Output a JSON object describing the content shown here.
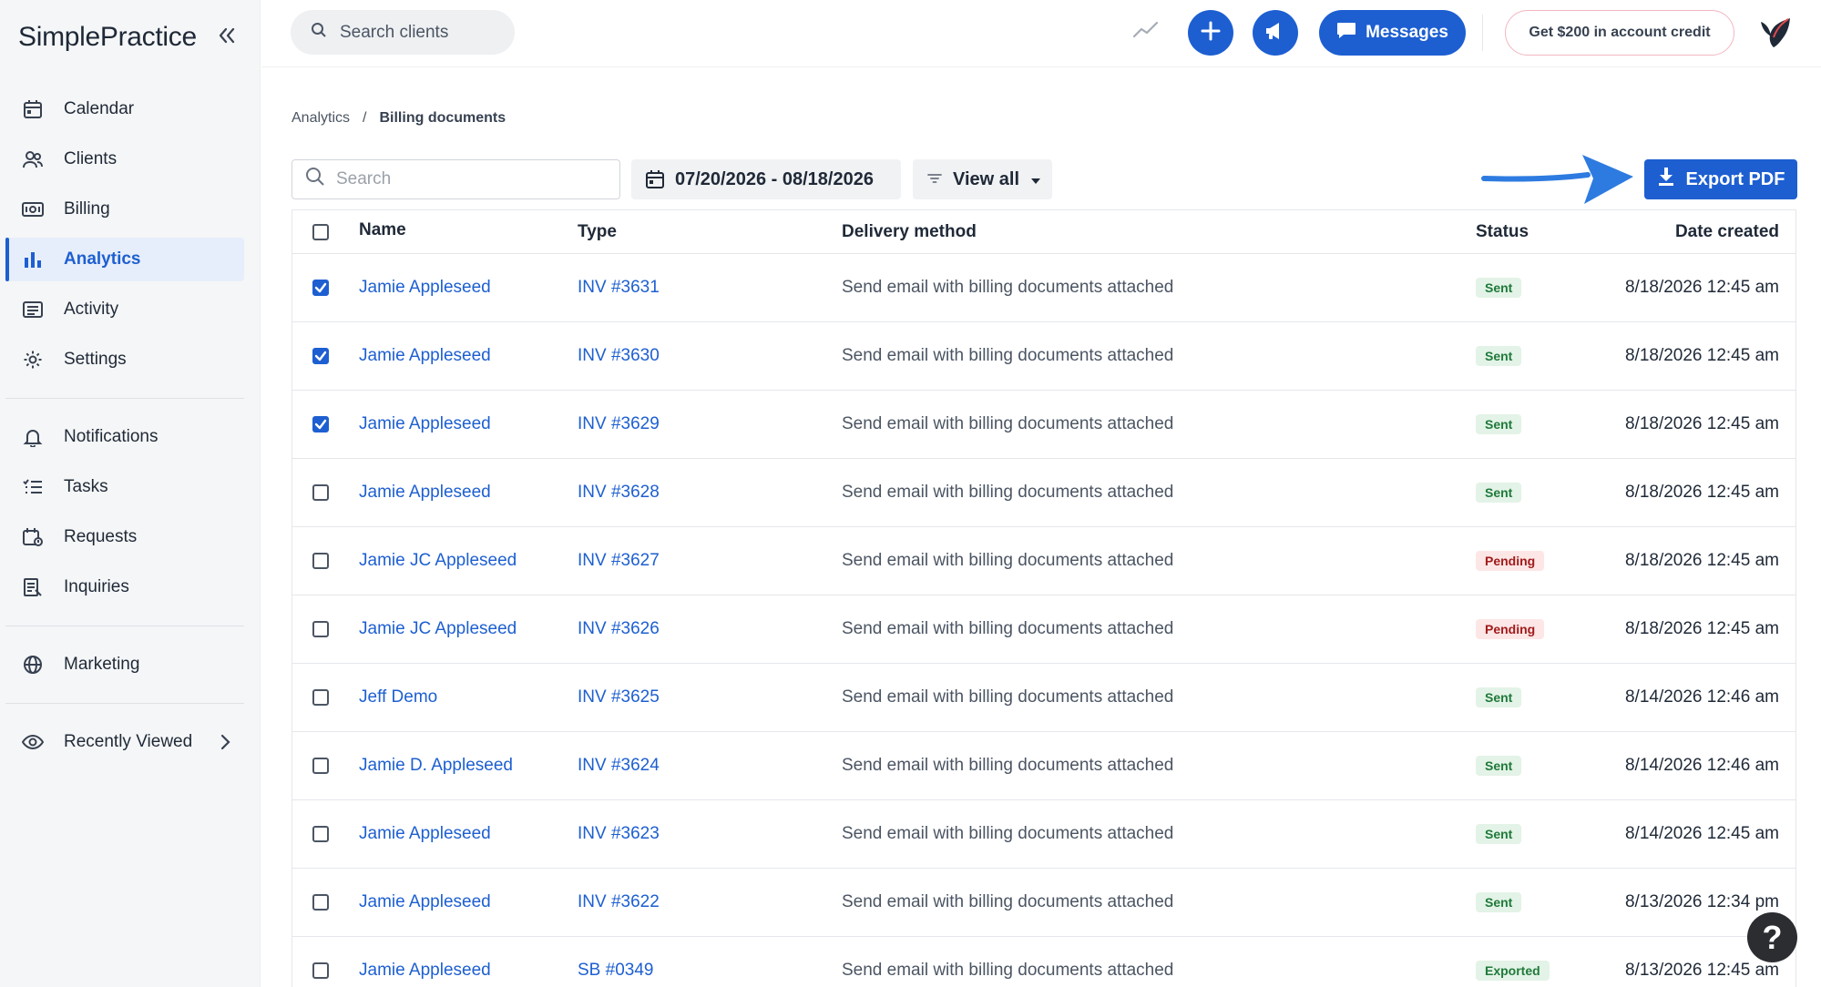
{
  "app": {
    "logo": "SimplePractice"
  },
  "sidebar": {
    "items": [
      {
        "label": "Calendar",
        "icon": "calendar-icon"
      },
      {
        "label": "Clients",
        "icon": "users-icon"
      },
      {
        "label": "Billing",
        "icon": "billing-icon"
      },
      {
        "label": "Analytics",
        "icon": "bar-chart-icon",
        "active": true
      },
      {
        "label": "Activity",
        "icon": "activity-icon"
      },
      {
        "label": "Settings",
        "icon": "gear-icon"
      },
      {
        "label": "Notifications",
        "icon": "bell-icon"
      },
      {
        "label": "Tasks",
        "icon": "tasks-icon"
      },
      {
        "label": "Requests",
        "icon": "requests-icon"
      },
      {
        "label": "Inquiries",
        "icon": "inquiries-icon"
      },
      {
        "label": "Marketing",
        "icon": "globe-icon"
      },
      {
        "label": "Recently Viewed",
        "icon": "eye-icon"
      }
    ]
  },
  "topbar": {
    "search_placeholder": "Search clients",
    "messages_label": "Messages",
    "credit_label": "Get $200 in account credit"
  },
  "breadcrumb": {
    "parent": "Analytics",
    "separator": "/",
    "current": "Billing documents"
  },
  "toolbar": {
    "search_placeholder": "Search",
    "date_range": "07/20/2026 - 08/18/2026",
    "filter_label": "View all",
    "export_label": "Export PDF"
  },
  "table": {
    "headers": {
      "name": "Name",
      "type": "Type",
      "delivery": "Delivery method",
      "status": "Status",
      "date": "Date created"
    },
    "rows": [
      {
        "checked": true,
        "name": "Jamie Appleseed",
        "type": "INV #3631",
        "delivery": "Send email with billing documents attached",
        "status": "Sent",
        "status_kind": "sent",
        "date": "8/18/2026 12:45 am"
      },
      {
        "checked": true,
        "name": "Jamie Appleseed",
        "type": "INV #3630",
        "delivery": "Send email with billing documents attached",
        "status": "Sent",
        "status_kind": "sent",
        "date": "8/18/2026 12:45 am"
      },
      {
        "checked": true,
        "name": "Jamie Appleseed",
        "type": "INV #3629",
        "delivery": "Send email with billing documents attached",
        "status": "Sent",
        "status_kind": "sent",
        "date": "8/18/2026 12:45 am"
      },
      {
        "checked": false,
        "name": "Jamie Appleseed",
        "type": "INV #3628",
        "delivery": "Send email with billing documents attached",
        "status": "Sent",
        "status_kind": "sent",
        "date": "8/18/2026 12:45 am"
      },
      {
        "checked": false,
        "name": "Jamie JC Appleseed",
        "type": "INV #3627",
        "delivery": "Send email with billing documents attached",
        "status": "Pending",
        "status_kind": "pending",
        "date": "8/18/2026 12:45 am"
      },
      {
        "checked": false,
        "name": "Jamie JC Appleseed",
        "type": "INV #3626",
        "delivery": "Send email with billing documents attached",
        "status": "Pending",
        "status_kind": "pending",
        "date": "8/18/2026 12:45 am"
      },
      {
        "checked": false,
        "name": "Jeff Demo",
        "type": "INV #3625",
        "delivery": "Send email with billing documents attached",
        "status": "Sent",
        "status_kind": "sent",
        "date": "8/14/2026 12:46 am"
      },
      {
        "checked": false,
        "name": "Jamie D. Appleseed",
        "type": "INV #3624",
        "delivery": "Send email with billing documents attached",
        "status": "Sent",
        "status_kind": "sent",
        "date": "8/14/2026 12:46 am"
      },
      {
        "checked": false,
        "name": "Jamie Appleseed",
        "type": "INV #3623",
        "delivery": "Send email with billing documents attached",
        "status": "Sent",
        "status_kind": "sent",
        "date": "8/14/2026 12:45 am"
      },
      {
        "checked": false,
        "name": "Jamie Appleseed",
        "type": "INV #3622",
        "delivery": "Send email with billing documents attached",
        "status": "Sent",
        "status_kind": "sent",
        "date": "8/13/2026 12:34 pm"
      },
      {
        "checked": false,
        "name": "Jamie Appleseed",
        "type": "SB #0349",
        "delivery": "Send email with billing documents attached",
        "status": "Exported",
        "status_kind": "exported",
        "date": "8/13/2026 12:45 am"
      }
    ]
  },
  "colors": {
    "accent": "#1d5fd1",
    "sent_bg": "#e3f3e7",
    "pending_bg": "#fde6e6"
  },
  "help": {
    "label": "?"
  }
}
